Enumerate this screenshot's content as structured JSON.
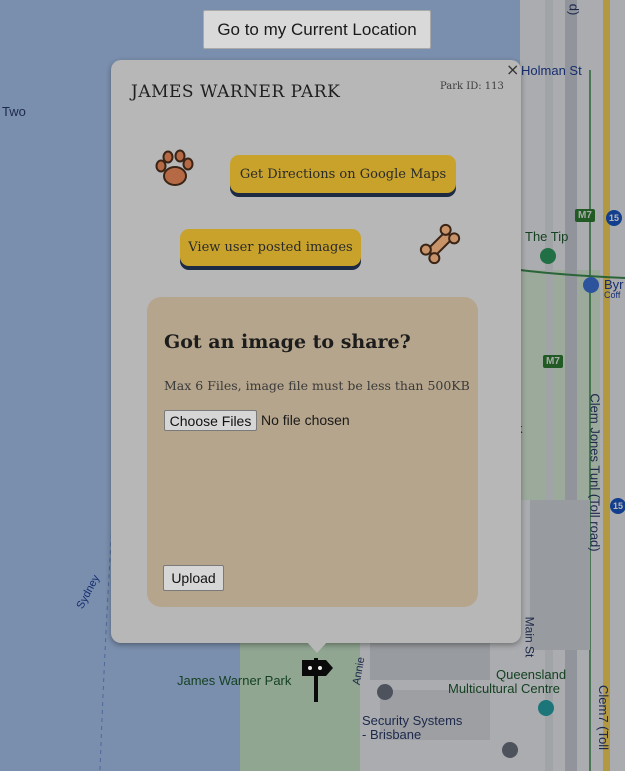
{
  "map": {
    "labels": {
      "holman_st": "Holman St",
      "two": "Two",
      "the_tip": "The Tip",
      "byr": "Byr",
      "coff": "Coff",
      "m7_a": "M7",
      "m7_b": "M7",
      "route_15_a": "15",
      "route_15_b": "15",
      "clem_jones": "Clem Jones Tunl (Toll road)",
      "clem7": "Clem7 (Toll",
      "sydney": "Sydney",
      "annie": "Annie",
      "main_st": "Main St",
      "james_warner_park": "James Warner Park",
      "qld_multicultural_line1": "Queensland",
      "qld_multicultural_line2": "Multicultural Centre",
      "security_line1": "Security Systems",
      "security_line2": "- Brisbane",
      "k": "k",
      "d": "d)"
    },
    "colors": {
      "water": "#aac7f2",
      "land": "#eceff3",
      "park": "#c8e6c9",
      "road_yellow": "#f6d35b"
    }
  },
  "location_button": {
    "label": "Go to my Current Location"
  },
  "popup": {
    "close_label": "×",
    "park_name": "JAMES WARNER PARK",
    "park_id": "Park ID: 113",
    "directions_button": "Get Directions on Google Maps",
    "images_button": "View user posted images",
    "share": {
      "title": "Got an image to share?",
      "note": "Max 6 Files, image file must be less than 500KB",
      "choose_label": "Choose Files",
      "no_file_text": "No file chosen",
      "upload_label": "Upload"
    },
    "icons": {
      "paw": "paw-icon",
      "bone": "bone-icon"
    }
  },
  "marker": {
    "icon": "signpost-icon"
  }
}
